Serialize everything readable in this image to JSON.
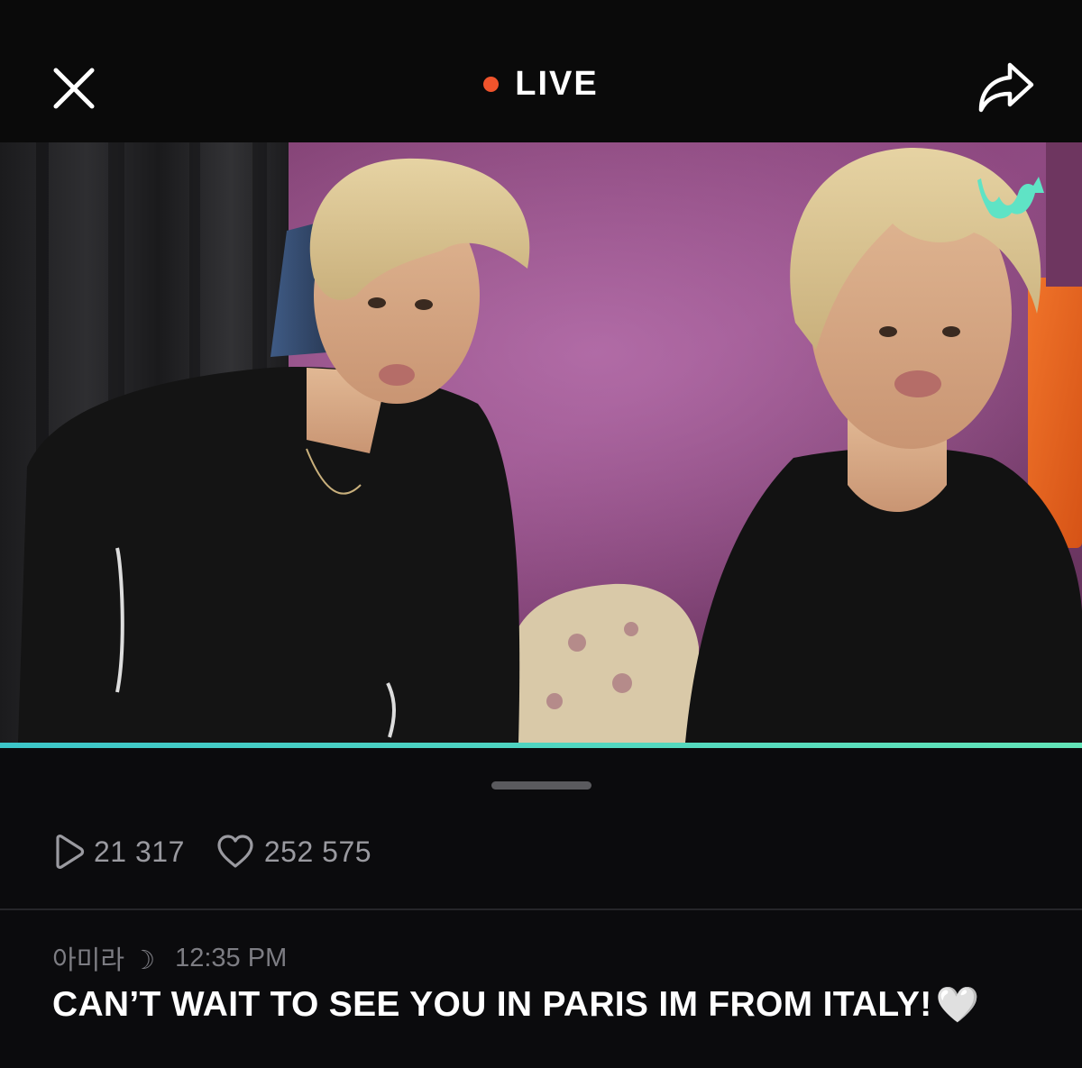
{
  "header": {
    "close_icon": "close-icon",
    "status_label": "LIVE",
    "status_color": "#f0542c",
    "share_icon": "share-icon"
  },
  "player": {
    "watermark_icon": "weverse-logo",
    "accent_color": "#3cc6c9",
    "progress": 1.0
  },
  "stats": {
    "views_icon": "play-icon",
    "views": "21 317",
    "likes_icon": "heart-icon",
    "likes": "252 575"
  },
  "comment": {
    "user": "아미라 ☽",
    "time": "12:35 PM",
    "text": "CAN’T WAIT TO SEE YOU IN PARIS IM FROM ITALY!",
    "emoji": "🤍"
  }
}
